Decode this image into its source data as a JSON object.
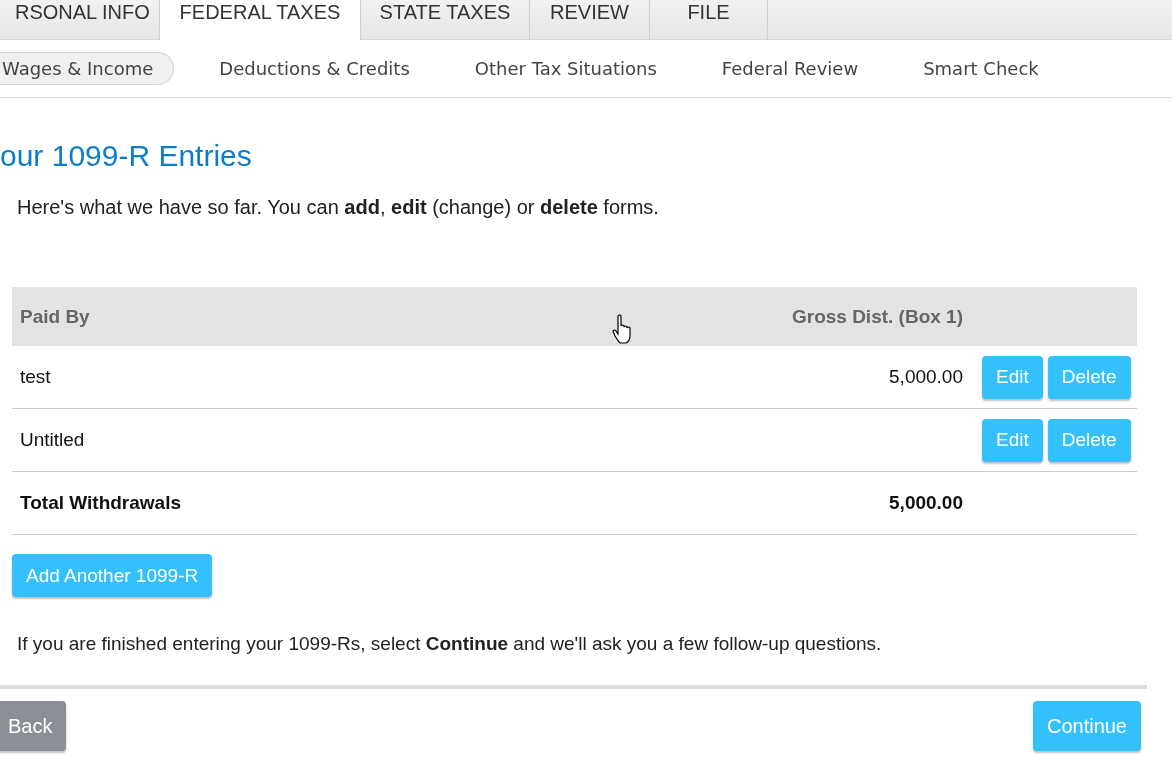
{
  "tabs": [
    {
      "label": "RSONAL INFO",
      "selected": false
    },
    {
      "label": "FEDERAL TAXES",
      "selected": true
    },
    {
      "label": "STATE TAXES",
      "selected": false
    },
    {
      "label": "REVIEW",
      "selected": false
    },
    {
      "label": "FILE",
      "selected": false
    }
  ],
  "subnav": [
    {
      "label": "Wages & Income",
      "selected": true
    },
    {
      "label": "Deductions & Credits",
      "selected": false
    },
    {
      "label": "Other Tax Situations",
      "selected": false
    },
    {
      "label": "Federal Review",
      "selected": false
    },
    {
      "label": "Smart Check",
      "selected": false
    }
  ],
  "heading": "our 1099-R Entries",
  "intro": "Here's what we have so far. You can **add**, **edit** (change) or **delete** forms.",
  "table": {
    "columns": [
      "Paid By",
      "Gross Dist. (Box 1)"
    ],
    "rows": [
      {
        "kind": "entry",
        "paid_by": "test",
        "amount": "5,000.00",
        "actions": [
          "Edit",
          "Delete"
        ]
      },
      {
        "kind": "entry",
        "paid_by": "Untitled",
        "actions": [
          "Edit",
          "Delete"
        ]
      },
      {
        "kind": "total",
        "paid_by": "Total Withdrawals",
        "amount": "5,000.00"
      }
    ]
  },
  "add_button": "Add Another 1099-R",
  "footer_note": "If you are finished entering your 1099-Rs, select **Continue** and we'll ask you a few follow-up questions.",
  "back_button": "Back",
  "continue_button": "Continue"
}
